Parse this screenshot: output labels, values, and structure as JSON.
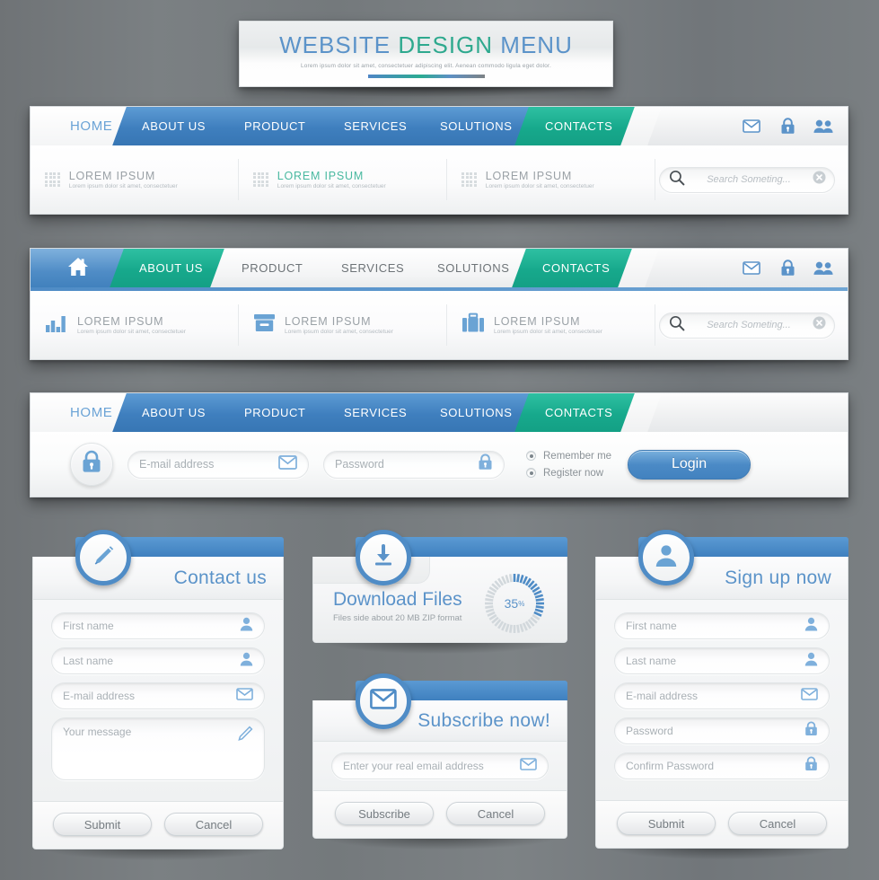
{
  "header": {
    "title_part1": "WEBSITE",
    "title_part2": "DESIGN",
    "title_part3": "MENU",
    "subtitle": "Lorem ipsum dolor sit amet, consectetuer adipiscing elit. Aenean commodo ligula eget dolor."
  },
  "colors": {
    "blue": "#4f8cc6",
    "teal": "#17a98c",
    "text_blue": "#5b93c9",
    "background": "#767a7d"
  },
  "navbar1": {
    "tabs": [
      {
        "label": "HOME",
        "style": "home"
      },
      {
        "label": "ABOUT US",
        "style": "blue"
      },
      {
        "label": "PRODUCT",
        "style": "blue"
      },
      {
        "label": "SERVICES",
        "style": "blue"
      },
      {
        "label": "SOLUTIONS",
        "style": "blue"
      },
      {
        "label": "CONTACTS",
        "style": "teal"
      }
    ],
    "icons": [
      "envelope-icon",
      "lock-icon",
      "users-icon"
    ],
    "features": [
      {
        "icon": "grid-icon",
        "title": "LOREM IPSUM",
        "subtitle": "Lorem ipsum dolor sit amet, consectetuer",
        "accent": "grey"
      },
      {
        "icon": "grid-icon",
        "title": "LOREM IPSUM",
        "subtitle": "Lorem ipsum dolor sit amet, consectetuer",
        "accent": "teal"
      },
      {
        "icon": "grid-icon",
        "title": "LOREM IPSUM",
        "subtitle": "Lorem ipsum dolor sit amet, consectetuer",
        "accent": "grey"
      }
    ],
    "search": {
      "placeholder": "Search Someting...",
      "value": ""
    }
  },
  "navbar2": {
    "tabs": [
      {
        "label": "",
        "style": "bluehome",
        "icon": "home-icon"
      },
      {
        "label": "ABOUT US",
        "style": "teal"
      },
      {
        "label": "PRODUCT",
        "style": "white"
      },
      {
        "label": "SERVICES",
        "style": "white"
      },
      {
        "label": "SOLUTIONS",
        "style": "white"
      },
      {
        "label": "CONTACTS",
        "style": "teal"
      }
    ],
    "icons": [
      "envelope-icon",
      "lock-icon",
      "users-icon"
    ],
    "features": [
      {
        "icon": "bar-chart-icon",
        "title": "LOREM IPSUM",
        "subtitle": "Lorem ipsum dolor sit amet, consectetuer"
      },
      {
        "icon": "archive-box-icon",
        "title": "LOREM IPSUM",
        "subtitle": "Lorem ipsum dolor sit amet, consectetuer"
      },
      {
        "icon": "briefcase-icon",
        "title": "LOREM IPSUM",
        "subtitle": "Lorem ipsum dolor sit amet, consectetuer"
      }
    ],
    "search": {
      "placeholder": "Search Someting...",
      "value": ""
    }
  },
  "navbar3": {
    "tabs": [
      {
        "label": "HOME",
        "style": "home"
      },
      {
        "label": "ABOUT US",
        "style": "blue"
      },
      {
        "label": "PRODUCT",
        "style": "blue"
      },
      {
        "label": "SERVICES",
        "style": "blue"
      },
      {
        "label": "SOLUTIONS",
        "style": "blue"
      },
      {
        "label": "CONTACTS",
        "style": "teal"
      }
    ],
    "login": {
      "badge_icon": "lock-icon",
      "email": {
        "placeholder": "E-mail address",
        "value": "",
        "icon": "envelope-icon"
      },
      "password": {
        "placeholder": "Password",
        "value": "",
        "icon": "lock-icon"
      },
      "radio1": "Remember me",
      "radio2": "Register now",
      "button": "Login"
    }
  },
  "contact_card": {
    "badge_icon": "pencil-icon",
    "title": "Contact us",
    "fields": [
      {
        "placeholder": "First name",
        "value": "",
        "icon": "user-icon"
      },
      {
        "placeholder": "Last name",
        "value": "",
        "icon": "user-icon"
      },
      {
        "placeholder": "E-mail address",
        "value": "",
        "icon": "envelope-icon"
      }
    ],
    "message": {
      "placeholder": "Your message",
      "value": "",
      "icon": "pencil-icon"
    },
    "submit": "Submit",
    "cancel": "Cancel"
  },
  "download_card": {
    "badge_icon": "download-icon",
    "title": "Download Files",
    "subtitle": "Files side about 20 MB ZIP format",
    "progress_value": 35,
    "progress_label": "35",
    "progress_unit": "%"
  },
  "subscribe_card": {
    "badge_icon": "envelope-icon",
    "title": "Subscribe now!",
    "email": {
      "placeholder": "Enter your real email address",
      "value": "",
      "icon": "envelope-icon"
    },
    "submit": "Subscribe",
    "cancel": "Cancel"
  },
  "signup_card": {
    "badge_icon": "user-icon",
    "title": "Sign up now",
    "fields": [
      {
        "placeholder": "First name",
        "value": "",
        "icon": "user-icon"
      },
      {
        "placeholder": "Last name",
        "value": "",
        "icon": "user-icon"
      },
      {
        "placeholder": "E-mail address",
        "value": "",
        "icon": "envelope-icon"
      },
      {
        "placeholder": "Password",
        "value": "",
        "icon": "lock-icon"
      },
      {
        "placeholder": "Confirm Password",
        "value": "",
        "icon": "lock-icon"
      }
    ],
    "submit": "Submit",
    "cancel": "Cancel"
  }
}
